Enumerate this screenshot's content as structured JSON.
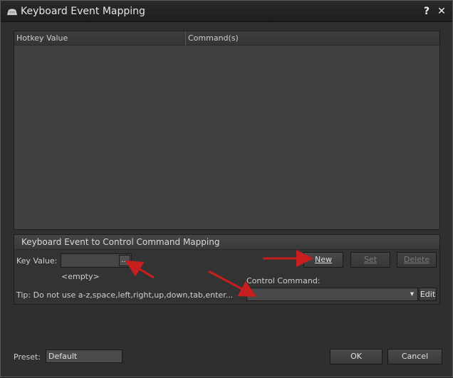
{
  "window": {
    "title": "Keyboard Event Mapping",
    "help_label": "?",
    "close_label": "✕"
  },
  "table": {
    "columns": [
      "Hotkey Value",
      "Command(s)"
    ],
    "rows": []
  },
  "mapping_group": {
    "title": "Keyboard Event to Control Command Mapping",
    "key_value_label": "Key Value:",
    "key_value": "",
    "browse_label": "...",
    "empty_text": "<empty>",
    "tip": "Tip: Do not use a-z,space,left,right,up,down,tab,enter...",
    "control_command_label": "Control Command:",
    "control_command_value": "",
    "buttons": {
      "new": "New",
      "set": "Set",
      "delete": "Delete",
      "edit": "Edit"
    }
  },
  "footer": {
    "preset_label": "Preset:",
    "preset_value": "Default",
    "ok": "OK",
    "cancel": "Cancel"
  },
  "colors": {
    "arrow": "#c81e1e",
    "background": "#2f2f2f",
    "panel": "#404040"
  }
}
